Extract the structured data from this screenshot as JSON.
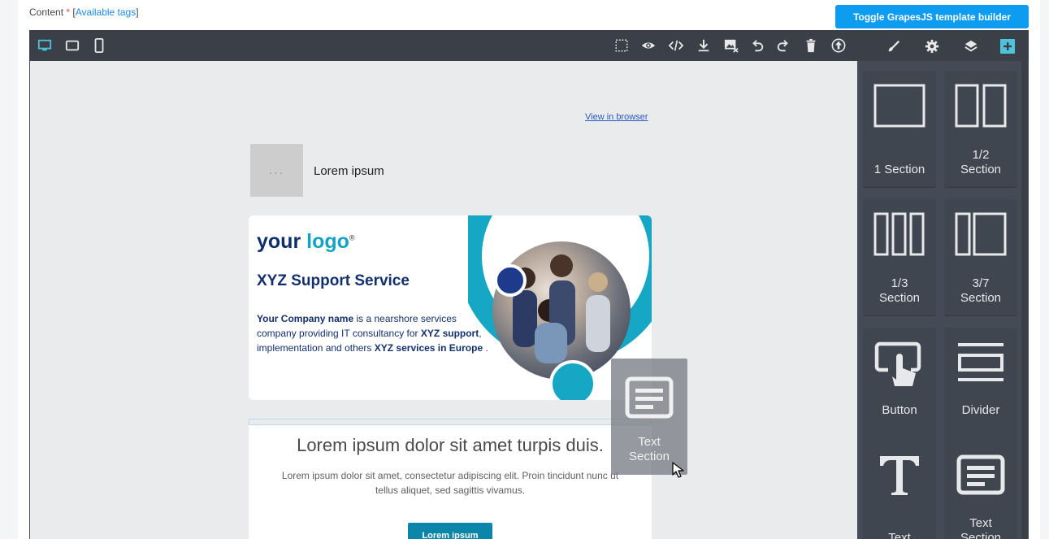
{
  "form": {
    "label": "Content",
    "required_mark": "*",
    "tags_open": "[",
    "tags_link": "Available tags",
    "tags_close": "]",
    "toggle_button": "Toggle GrapesJS template builder"
  },
  "colors": {
    "accent": "#0d9cf0",
    "toolbar": "#3a3f48",
    "panel": "#444b56",
    "active_icon": "#4fc3dc"
  },
  "toolbar": {
    "devices": [
      "desktop-icon",
      "tablet-icon",
      "mobile-icon"
    ],
    "actions": [
      "select-outline-icon",
      "eye-icon",
      "code-icon",
      "download-icon",
      "image-remove-icon",
      "undo-icon",
      "redo-icon",
      "trash-icon",
      "upload-icon"
    ],
    "panels": [
      "brush-icon",
      "gear-icon",
      "layers-icon",
      "add-block-icon"
    ]
  },
  "email": {
    "view_in_browser": "View in browser",
    "placeholder": "...",
    "header_text": "Lorem ipsum",
    "logo_your": "your",
    "logo_logo": "logo",
    "logo_reg": "®",
    "hero_title": "XYZ Support Service",
    "hero_p1_bold": "Your Company name",
    "hero_p1": " is a nearshore services company providing IT consultancy for ",
    "hero_p2_bold": "XYZ support",
    "hero_p2": ", implementation and others ",
    "hero_p3_bold": "XYZ services in Europe",
    "hero_p3": " .",
    "body_title": "Lorem ipsum dolor sit amet turpis duis.",
    "body_text": "Lorem ipsum dolor sit amet, consectetur adipiscing elit. Proin tincidunt nunc ut tellus aliquet, sed sagittis vivamus.",
    "cta": "Lorem ipsum"
  },
  "drag_ghost": {
    "label_line1": "Text",
    "label_line2": "Section"
  },
  "blocks": [
    {
      "icon": "one-section-icon",
      "line1": "",
      "line2": "1 Section"
    },
    {
      "icon": "half-section-icon",
      "line1": "1/2",
      "line2": "Section"
    },
    {
      "icon": "third-section-icon",
      "line1": "1/3",
      "line2": "Section"
    },
    {
      "icon": "three-seven-section-icon",
      "line1": "3/7",
      "line2": "Section"
    },
    {
      "icon": "button-block-icon",
      "line1": "",
      "line2": "Button"
    },
    {
      "icon": "divider-block-icon",
      "line1": "",
      "line2": "Divider"
    },
    {
      "icon": "text-block-icon",
      "line1": "",
      "line2": "Text"
    },
    {
      "icon": "text-section-block-icon",
      "line1": "Text",
      "line2": "Section"
    }
  ]
}
